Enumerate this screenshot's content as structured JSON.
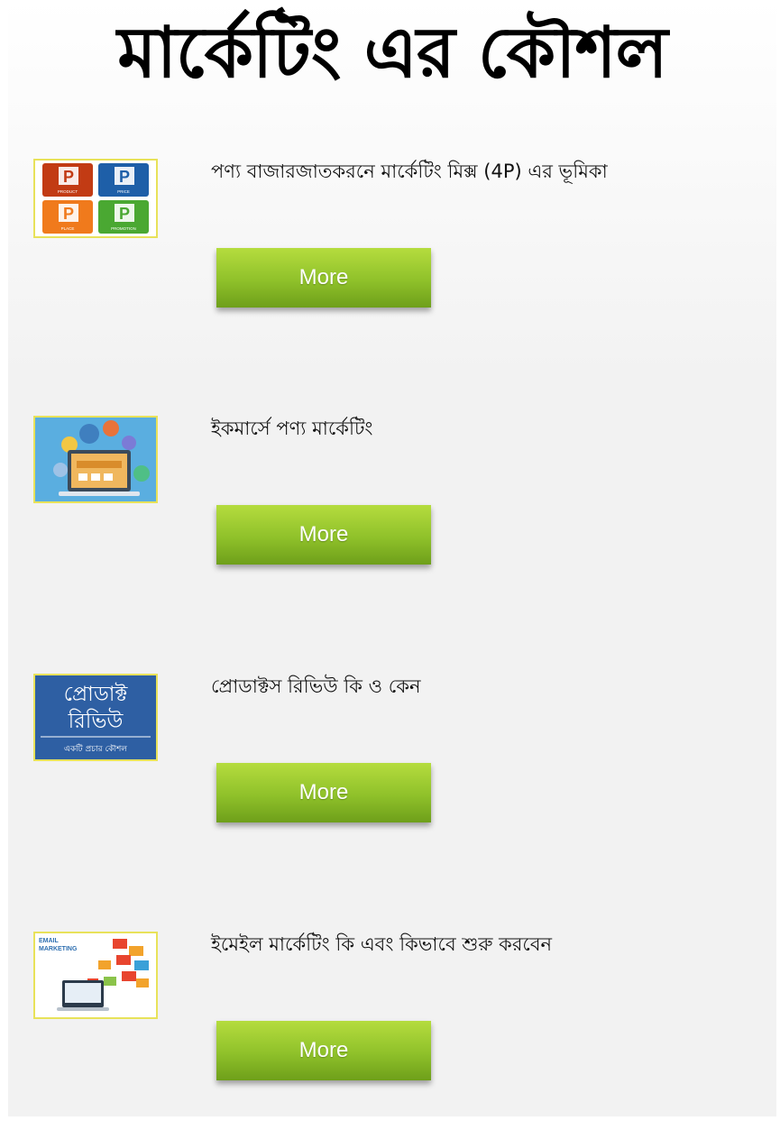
{
  "header": {
    "title": "মার্কেটিং এর কৌশল"
  },
  "articles": [
    {
      "title": "পণ্য বাজারজাতকরনে মার্কেটিং মিক্স (4P) এর ভূমিকা",
      "button_label": "More",
      "thumb": {
        "icon": "4p-marketing-mix-image",
        "letter": "P",
        "captions": [
          "PRODUCT",
          "PRICE",
          "PLACE",
          "PROMOTION"
        ]
      }
    },
    {
      "title": "ইকমার্সে পণ্য মার্কেটিং",
      "button_label": "More",
      "thumb": {
        "icon": "ecommerce-laptop-image"
      }
    },
    {
      "title": "প্রোডাক্টস রিভিউ কি ও কেন",
      "button_label": "More",
      "thumb": {
        "icon": "product-review-image",
        "line1": "প্রোডাক্ট",
        "line2": "রিভিউ",
        "line3": "একটি প্রচার কৌশল"
      }
    },
    {
      "title": "ইমেইল মার্কেটিং কি এবং কিভাবে শুরু করবেন",
      "button_label": "More",
      "thumb": {
        "icon": "email-marketing-image",
        "line1": "EMAIL",
        "line2": "MARKETING"
      }
    }
  ],
  "colors": {
    "button_green": "#8fc12a",
    "thumb_border": "#e8e25a",
    "review_blue": "#2e5fa3"
  }
}
